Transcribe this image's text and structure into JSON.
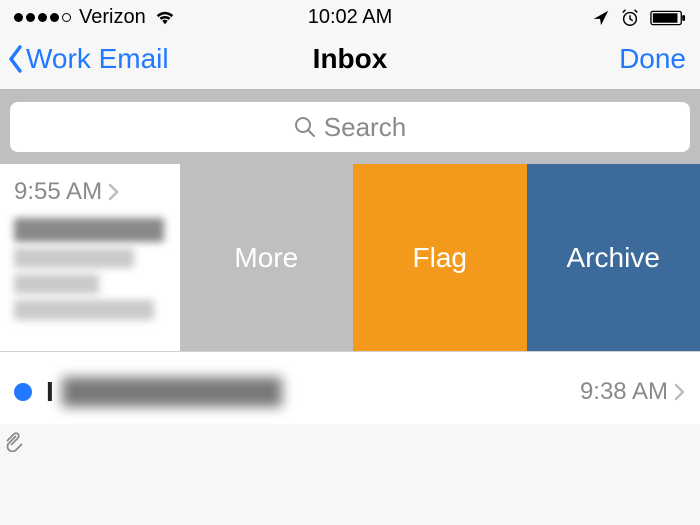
{
  "status": {
    "carrier": "Verizon",
    "time": "10:02 AM"
  },
  "nav": {
    "back_label": "Work Email",
    "title": "Inbox",
    "done_label": "Done"
  },
  "search": {
    "placeholder": "Search"
  },
  "swipe_actions": {
    "more": "More",
    "flag": "Flag",
    "archive": "Archive"
  },
  "messages": [
    {
      "time": "9:55 AM",
      "unread": false
    },
    {
      "time": "9:38 AM",
      "unread": true
    }
  ]
}
